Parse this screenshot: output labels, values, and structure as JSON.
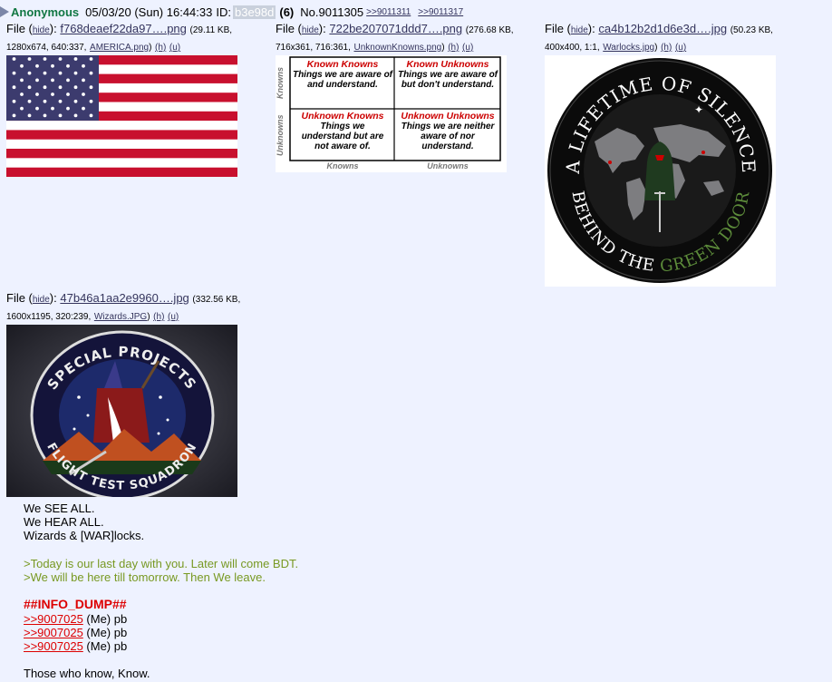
{
  "post": {
    "name": "Anonymous",
    "datetime": "05/03/20 (Sun) 16:44:33",
    "id_label": "ID:",
    "id_value": "b3e98d",
    "id_count": "(6)",
    "number": "No.9011305",
    "backlinks": [
      ">>9011311",
      ">>9011317"
    ]
  },
  "files": [
    {
      "prefix": "File (",
      "hide": "hide",
      "colon": "):",
      "filename": "f768deaef22da97….png",
      "meta1": "(29.11 KB,",
      "meta2": "1280x674, 640:337,",
      "orig": "AMERICA.png",
      "h": "(h)",
      "u": "(u)"
    },
    {
      "prefix": "File (",
      "hide": "hide",
      "colon": "):",
      "filename": "722be207071ddd7….png",
      "meta1": "(276.68 KB,",
      "meta2": "716x361, 716:361,",
      "orig": "UnknownKnowns.png",
      "h": "(h)",
      "u": "(u)"
    },
    {
      "prefix": "File (",
      "hide": "hide",
      "colon": "):",
      "filename": "ca4b12b2d1d6e3d….jpg",
      "meta1": "(50.23 KB,",
      "meta2": "400x400, 1:1,",
      "orig": "Warlocks.jpg",
      "h": "(h)",
      "u": "(u)"
    },
    {
      "prefix": "File (",
      "hide": "hide",
      "colon": "):",
      "filename": "47b46a1aa2e9960….jpg",
      "meta1": "(332.56 KB,",
      "meta2": "1600x1195, 320:239,",
      "orig": "Wizards.JPG",
      "h": "(h)",
      "u": "(u)"
    }
  ],
  "matrix": {
    "cells": [
      {
        "title": "Known Knowns",
        "body": "Things we are aware of and understand."
      },
      {
        "title": "Known Unknowns",
        "body": "Things we are aware of but don't understand."
      },
      {
        "title": "Unknown Knowns",
        "body": "Things we understand but are not aware of."
      },
      {
        "title": "Unknown Unknowns",
        "body": "Things we are neither aware of nor understand."
      }
    ],
    "row_labels": [
      "Knowns",
      "Unknowns"
    ],
    "col_labels": [
      "Knowns",
      "Unknowns"
    ]
  },
  "patch_warlocks": {
    "top_text": "A LIFETIME OF SILENCE",
    "bottom_text_1": "BEHIND THE",
    "bottom_text_2": "GREEN DOOR"
  },
  "patch_wizards": {
    "top_text": "SPECIAL PROJECTS",
    "bottom_text": "FLIGHT TEST SQUADRON"
  },
  "message": {
    "l1": "We SEE ALL.",
    "l2": "We HEAR ALL.",
    "l3": "Wizards & [WAR]locks.",
    "q1": ">Today is our last day with you. Later will come BDT.",
    "q2": ">We will be here till tomorrow. Then We leave.",
    "heading": "##INFO_DUMP##",
    "links": [
      {
        "ref": ">>9007025",
        "suffix": " (Me) pb"
      },
      {
        "ref": ">>9007025",
        "suffix": " (Me) pb"
      },
      {
        "ref": ">>9007025",
        "suffix": " (Me) pb"
      }
    ],
    "closing": "Those who know, Know."
  },
  "colors": {
    "background": "#eef2ff",
    "name": "#117743",
    "link": "#34345c",
    "greentext": "#789922",
    "redtext": "#dd0000"
  }
}
